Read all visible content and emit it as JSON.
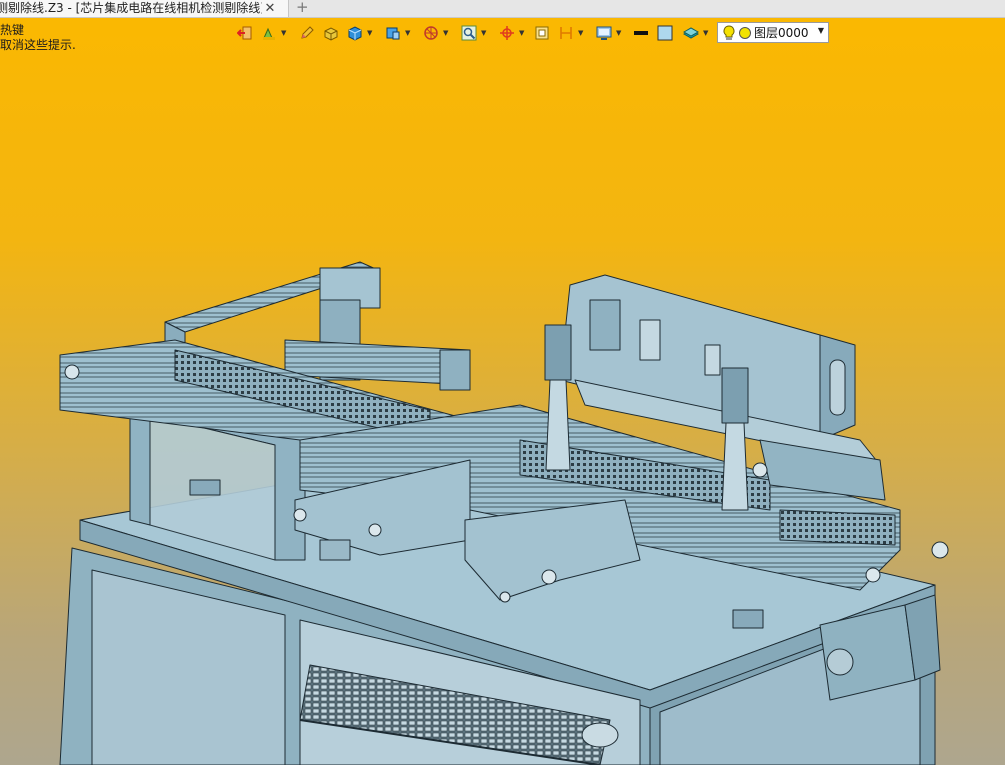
{
  "tab": {
    "title": "测剔除线.Z3 - [芯片集成电路在线相机检测剔除线]",
    "close_glyph": "✕",
    "add_glyph": "+"
  },
  "hint": {
    "line1": "热键",
    "line2": "取消这些提示."
  },
  "toolbar": {
    "icons": [
      "exit-icon",
      "paint-icon",
      "pencil-icon",
      "shaded-icon",
      "cube-icon",
      "box-view-icon",
      "render-icon",
      "zoom-icon",
      "target-icon",
      "frame-icon",
      "dimension-icon",
      "display-icon",
      "line-color-swatch",
      "fill-color-swatch",
      "layer-icon"
    ],
    "line_color": "#111111",
    "fill_color": "#aed8ee"
  },
  "layer": {
    "label": "图层0000",
    "bulb_color": "#f5e100",
    "dot_color": "#f2e300"
  },
  "colors": {
    "background_top": "#fbb800",
    "background_bottom": "#aea68e",
    "model_fill": "#9bbccb",
    "model_edge": "#1d2b33"
  }
}
